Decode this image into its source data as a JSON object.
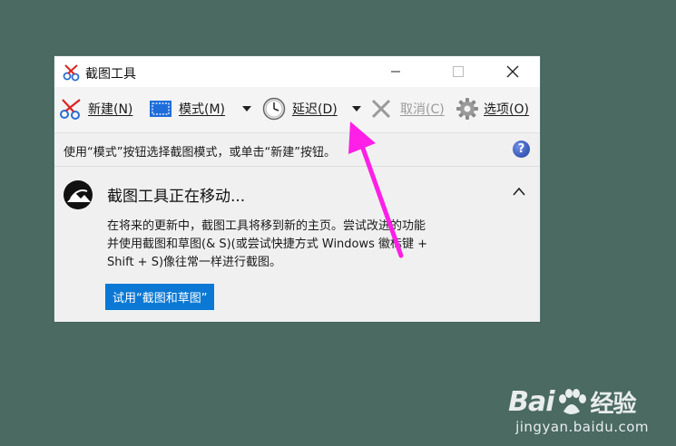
{
  "window": {
    "title": "截图工具",
    "icons": {
      "app": "snipping-scissors-icon",
      "minimize": "minimize-icon",
      "maximize": "maximize-icon",
      "close": "close-icon"
    }
  },
  "toolbar": {
    "new_label": "新建(N)",
    "mode_label": "模式(M)",
    "delay_label": "延迟(D)",
    "cancel_label": "取消(C)",
    "options_label": "选项(O)"
  },
  "infobar": {
    "text": "使用“模式”按钮选择截图模式，或单击“新建”按钮。",
    "help_glyph": "?"
  },
  "notice": {
    "title": "截图工具正在移动...",
    "body_lines": [
      "在将来的更新中，截图工具将移到新的主页。尝试改进的功能",
      "并使用截图和草图(& S)(或尝试快捷方式 Windows 徽标键 +",
      "Shift + S)像往常一样进行截图。"
    ],
    "button_label": "试用“截图和草图”"
  },
  "watermark": {
    "brand": "Bai",
    "brand_suffix": "经验",
    "url": "jingyan.baidu.com"
  },
  "colors": {
    "desktop": "#4a6a62",
    "accent": "#0a78d4",
    "annotation_arrow": "#ff1fe6"
  }
}
